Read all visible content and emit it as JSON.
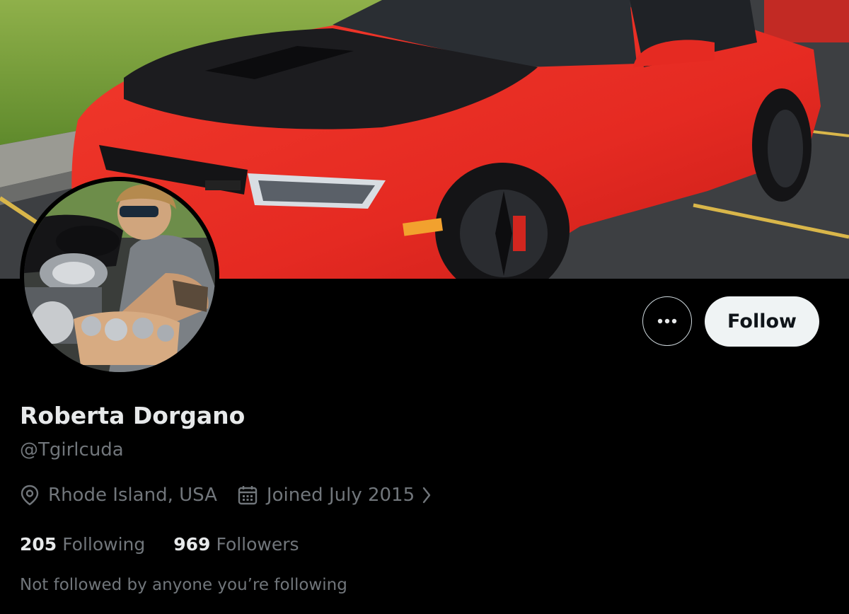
{
  "profile": {
    "display_name": "Roberta Dorgano",
    "handle": "@Tgirlcuda",
    "location": "Rhode Island, USA",
    "joined": "Joined July 2015",
    "following_count": "205",
    "following_label": "Following",
    "followers_count": "969",
    "followers_label": "Followers",
    "mutuals_note": "Not followed by anyone you’re following"
  },
  "actions": {
    "more_label": "•••",
    "follow_label": "Follow"
  },
  "icons": {
    "location": "location-pin-icon",
    "calendar": "calendar-icon",
    "chevron": "chevron-right-icon",
    "more": "more-options-icon"
  },
  "colors": {
    "background": "#000000",
    "primary_text": "#e7e9ea",
    "secondary_text": "#71767b",
    "follow_button_bg": "#eff3f4",
    "follow_button_text": "#0f1419",
    "banner_car": "#f0312a"
  }
}
